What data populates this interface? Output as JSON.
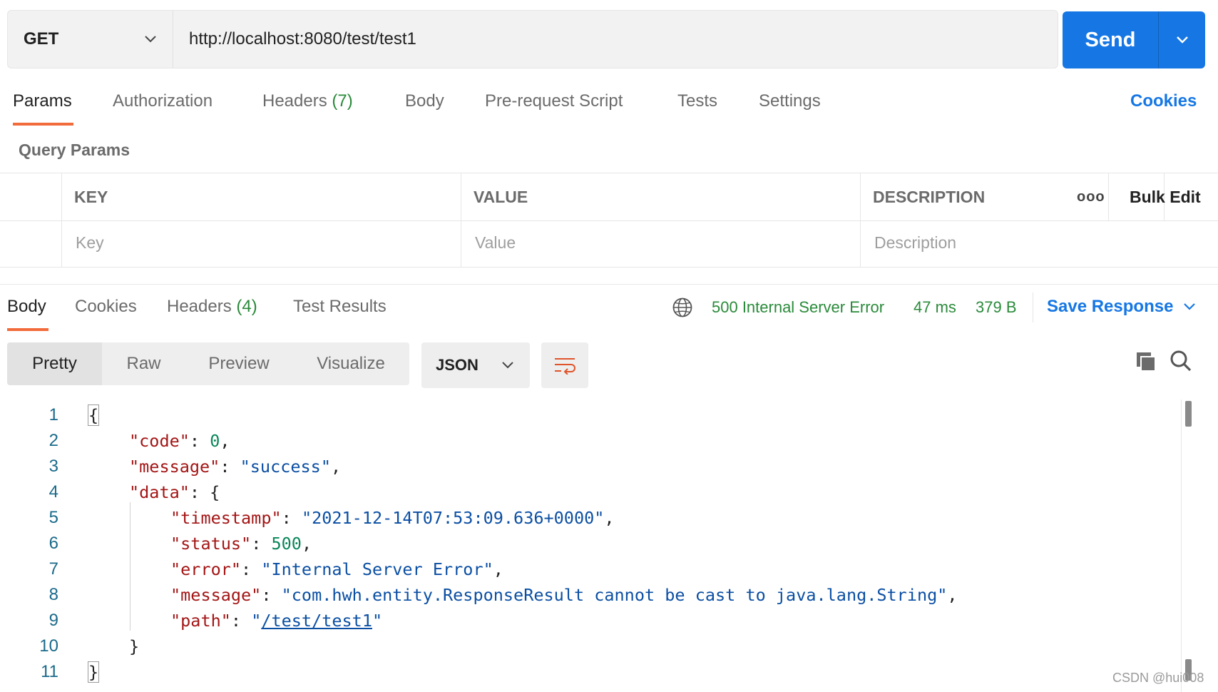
{
  "request": {
    "method": "GET",
    "url": "http://localhost:8080/test/test1",
    "send_label": "Send"
  },
  "request_tabs": {
    "params": "Params",
    "authorization": "Authorization",
    "headers": "Headers",
    "headers_count": "(7)",
    "body": "Body",
    "pre_request": "Pre-request Script",
    "tests": "Tests",
    "settings": "Settings",
    "cookies": "Cookies"
  },
  "query_params": {
    "title": "Query Params",
    "columns": {
      "key": "KEY",
      "value": "VALUE",
      "description": "DESCRIPTION"
    },
    "more": "ooo",
    "bulk_edit": "Bulk Edit",
    "placeholders": {
      "key": "Key",
      "value": "Value",
      "description": "Description"
    }
  },
  "response_tabs": {
    "body": "Body",
    "cookies": "Cookies",
    "headers": "Headers",
    "headers_count": "(4)",
    "test_results": "Test Results"
  },
  "response_meta": {
    "status": "500 Internal Server Error",
    "time": "47 ms",
    "size": "379 B",
    "save_response": "Save Response",
    "status_color": "#2a8a3a",
    "accent": "#1677e4"
  },
  "view": {
    "modes": [
      "Pretty",
      "Raw",
      "Preview",
      "Visualize"
    ],
    "active_mode": "Pretty",
    "format": "JSON"
  },
  "code": {
    "line_numbers": [
      "1",
      "2",
      "3",
      "4",
      "5",
      "6",
      "7",
      "8",
      "9",
      "10",
      "11"
    ],
    "keys": {
      "code": "\"code\"",
      "message": "\"message\"",
      "data": "\"data\"",
      "timestamp": "\"timestamp\"",
      "status": "\"status\"",
      "error": "\"error\"",
      "message2": "\"message\"",
      "path": "\"path\""
    },
    "values": {
      "code": "0",
      "message": "\"success\"",
      "timestamp": "\"2021-12-14T07:53:09.636+0000\"",
      "status": "500",
      "error": "\"Internal Server Error\"",
      "message2": "\"com.hwh.entity.ResponseResult cannot be cast to java.lang.String\"",
      "path_open": "\"",
      "path_link": "/test/test1",
      "path_close": "\""
    }
  },
  "watermark": "CSDN @hui008"
}
